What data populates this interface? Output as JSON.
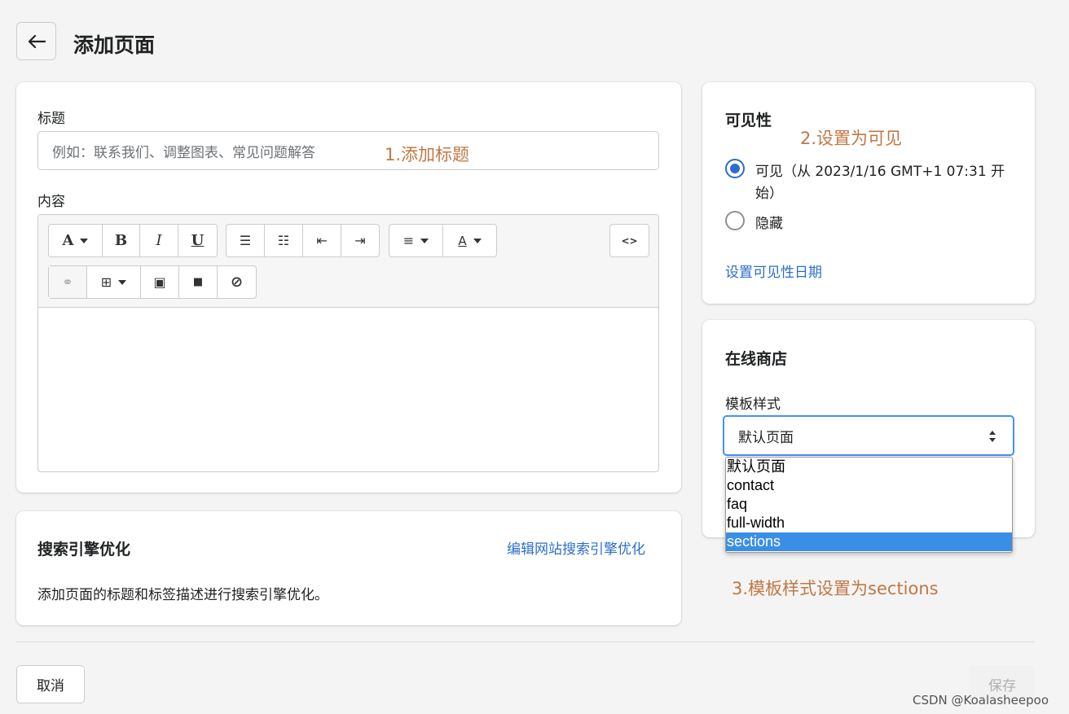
{
  "header": {
    "title": "添加页面"
  },
  "main": {
    "title_label": "标题",
    "title_placeholder": "例如：联系我们、调整图表、常见问题解答",
    "content_label": "内容",
    "toolbar": {
      "row1": [
        {
          "icon": "text-style-icon",
          "glyph": "A"
        },
        {
          "icon": "bold-icon",
          "glyph": "B"
        },
        {
          "icon": "italic-icon",
          "glyph": "I"
        },
        {
          "icon": "underline-icon",
          "glyph": "U"
        },
        {
          "icon": "bullet-list-icon",
          "glyph": "☰"
        },
        {
          "icon": "numbered-list-icon",
          "glyph": "☷"
        },
        {
          "icon": "outdent-icon",
          "glyph": "⇤"
        },
        {
          "icon": "indent-icon",
          "glyph": "⇥"
        },
        {
          "icon": "align-icon",
          "glyph": "≡"
        },
        {
          "icon": "text-color-icon",
          "glyph": "A"
        },
        {
          "icon": "code-view-icon",
          "glyph": "<>"
        }
      ],
      "row2": [
        {
          "icon": "link-icon",
          "glyph": "⚭"
        },
        {
          "icon": "table-icon",
          "glyph": "⊞"
        },
        {
          "icon": "image-icon",
          "glyph": "▣"
        },
        {
          "icon": "video-icon",
          "glyph": "■"
        },
        {
          "icon": "clear-format-icon",
          "glyph": "⊘"
        }
      ]
    }
  },
  "seo": {
    "title": "搜索引擎优化",
    "edit_link": "编辑网站搜索引擎优化",
    "description": "添加页面的标题和标签描述进行搜索引擎优化。"
  },
  "visibility": {
    "title": "可见性",
    "option_visible_line1": "可见（从 2023/1/16 GMT+1 07:31 开",
    "option_visible_line2": "始）",
    "option_hidden": "隐藏",
    "selected": "可见",
    "set_date_link": "设置可见性日期"
  },
  "online_store": {
    "title": "在线商店",
    "template_label": "模板样式",
    "selected_value": "默认页面",
    "options": [
      "默认页面",
      "contact",
      "faq",
      "full-width",
      "sections"
    ],
    "highlighted_option": "sections"
  },
  "annotations": {
    "step1": "1.添加标题",
    "step2": "2.设置为可见",
    "step3": "3.模板样式设置为sections"
  },
  "footer": {
    "cancel": "取消",
    "save": "保存"
  },
  "watermark": "CSDN @Koalasheepoo",
  "colors": {
    "accent": "#2c6ecb",
    "annotation": "#c07845",
    "focus_border": "#458fff",
    "option_highlight": "#3b8ee6"
  }
}
